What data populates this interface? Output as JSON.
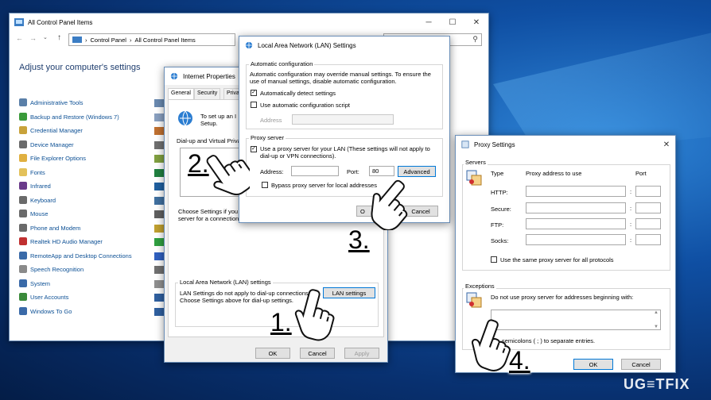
{
  "cp": {
    "title": "All Control Panel Items",
    "breadcrumb": [
      "Control Panel",
      "All Control Panel Items"
    ],
    "heading": "Adjust your computer's settings",
    "items": [
      "Administrative Tools",
      "Backup and Restore (Windows 7)",
      "Credential Manager",
      "Device Manager",
      "File Explorer Options",
      "Fonts",
      "Infrared",
      "Keyboard",
      "Mouse",
      "Phone and Modem",
      "Realtek HD Audio Manager",
      "RemoteApp and Desktop Connections",
      "Speech Recognition",
      "System",
      "User Accounts",
      "Windows To Go"
    ],
    "item_colors": [
      "#5a7fa8",
      "#3a9a3a",
      "#c8a23a",
      "#6a6a6a",
      "#e0b040",
      "#e3c15a",
      "#6a3a8a",
      "#6a6a6a",
      "#6a6a6a",
      "#6a6a6a",
      "#c03030",
      "#3a6aa8",
      "#8a8a8a",
      "#3a6aa8",
      "#3a8a3a",
      "#3a6aa8"
    ]
  },
  "ip": {
    "title": "Internet Properties",
    "tabs": [
      "General",
      "Security",
      "Priva"
    ],
    "setup_text_1": "To set up an I",
    "setup_text_2": "Setup.",
    "dialup_label": "Dial-up and Virtual Priva",
    "choose_1": "Choose Settings if you",
    "choose_2": "server for a connection",
    "lan_group": "Local Area Network (LAN) settings",
    "lan_text_1": "LAN Settings do not apply to dial-up connections.",
    "lan_text_2": "Choose Settings above for dial-up settings.",
    "lan_button": "LAN settings",
    "ok": "OK",
    "cancel": "Cancel",
    "apply": "Apply"
  },
  "lan": {
    "title": "Local Area Network (LAN) Settings",
    "auto_group": "Automatic configuration",
    "auto_text_1": "Automatic configuration may override manual settings. To ensure the",
    "auto_text_2": "use of manual settings, disable automatic configuration.",
    "auto_detect": "Automatically detect settings",
    "auto_script": "Use automatic configuration script",
    "address_label": "Address",
    "proxy_group": "Proxy server",
    "use_proxy_1": "Use a proxy server for your LAN (These settings will not apply to",
    "use_proxy_2": "dial-up or VPN connections).",
    "proxy_address_label": "Address:",
    "port_label": "Port:",
    "port_value": "80",
    "advanced": "Advanced",
    "bypass": "Bypass proxy server for local addresses",
    "ok": "O",
    "cancel": "Cancel"
  },
  "ps": {
    "title": "Proxy Settings",
    "servers_group": "Servers",
    "col_type": "Type",
    "col_addr": "Proxy address to use",
    "col_port": "Port",
    "rows": [
      "HTTP:",
      "Secure:",
      "FTP:",
      "Socks:"
    ],
    "same_proxy": "Use the same proxy server for all protocols",
    "exceptions_group": "Exceptions",
    "exceptions_text": "Do not use proxy server for addresses beginning with:",
    "semicolons": "semicolons ( ; ) to separate entries.",
    "ok": "OK",
    "cancel": "Cancel"
  },
  "steps": [
    "1.",
    "2.",
    "3.",
    "4."
  ],
  "watermark": "UG≡TFIX",
  "colors": {
    "accent": "#0078d7",
    "link": "#0b4f94",
    "desktop": "#0f4fa3"
  }
}
